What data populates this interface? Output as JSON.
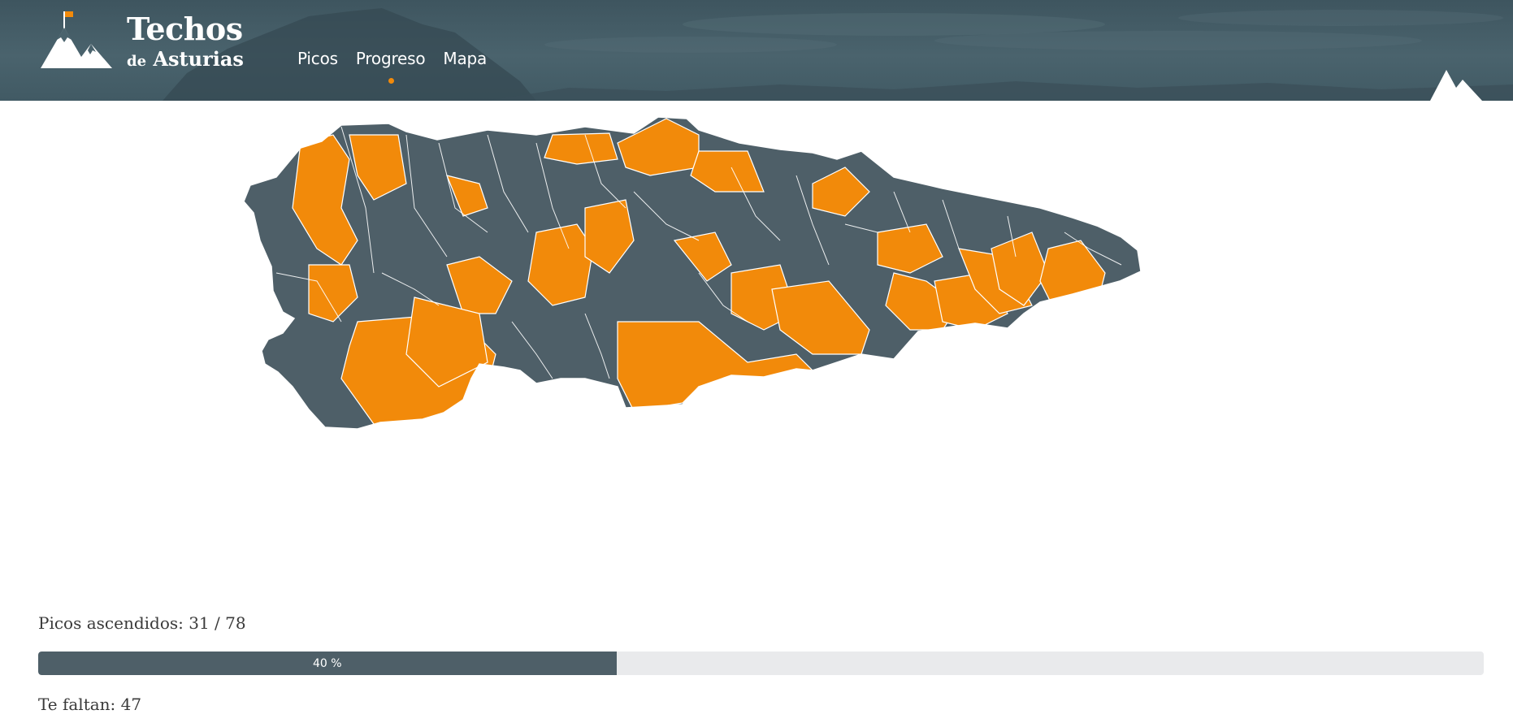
{
  "header": {
    "brand_main": "Techos",
    "brand_de": "de",
    "brand_region": "Asturias",
    "nav": [
      {
        "label": "Picos",
        "active": false
      },
      {
        "label": "Progreso",
        "active": true
      },
      {
        "label": "Mapa",
        "active": false
      }
    ],
    "logo_icon": "mountain-flag-icon"
  },
  "colors": {
    "header_bg": "#4a636d",
    "accent": "#f28a0a",
    "region_climbed": "#f28a0a",
    "region_pending": "#4e5f68",
    "progress_fill": "#4e5f68",
    "progress_track": "#e9eaec"
  },
  "progress": {
    "summary_label": "Picos ascendidos: 31 / 78",
    "climbed": 31,
    "total": 78,
    "percent": 40,
    "percent_label": "40 %",
    "remaining_label": "Te faltan: 47"
  }
}
